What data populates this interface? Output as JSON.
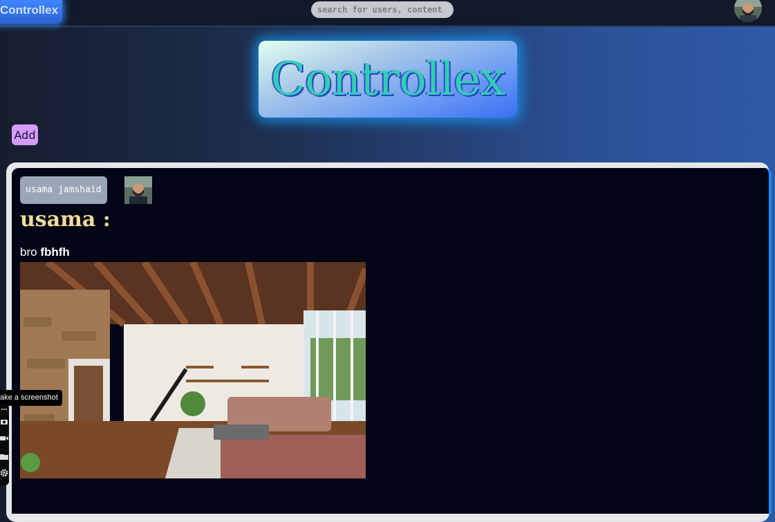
{
  "header": {
    "brand": "Controllex",
    "search_placeholder": "search for users, content"
  },
  "hero": {
    "title": "Controllex"
  },
  "actions": {
    "add_label": "Add"
  },
  "post": {
    "username": "usama jamshaid",
    "title": "usama :",
    "body_prefix": "bro",
    "body_bold": "fbhfh"
  },
  "screenshot_tool": {
    "tooltip": "ake a screenshot"
  },
  "colors": {
    "accent_blue": "#2f6bff",
    "add_button": "#d59bff",
    "post_title": "#f2dc9a",
    "hero_text": "#2fd0b0"
  },
  "icons": [
    "user-avatar-icon",
    "more-icon",
    "camera-icon",
    "video-icon",
    "folder-icon",
    "gear-icon"
  ]
}
